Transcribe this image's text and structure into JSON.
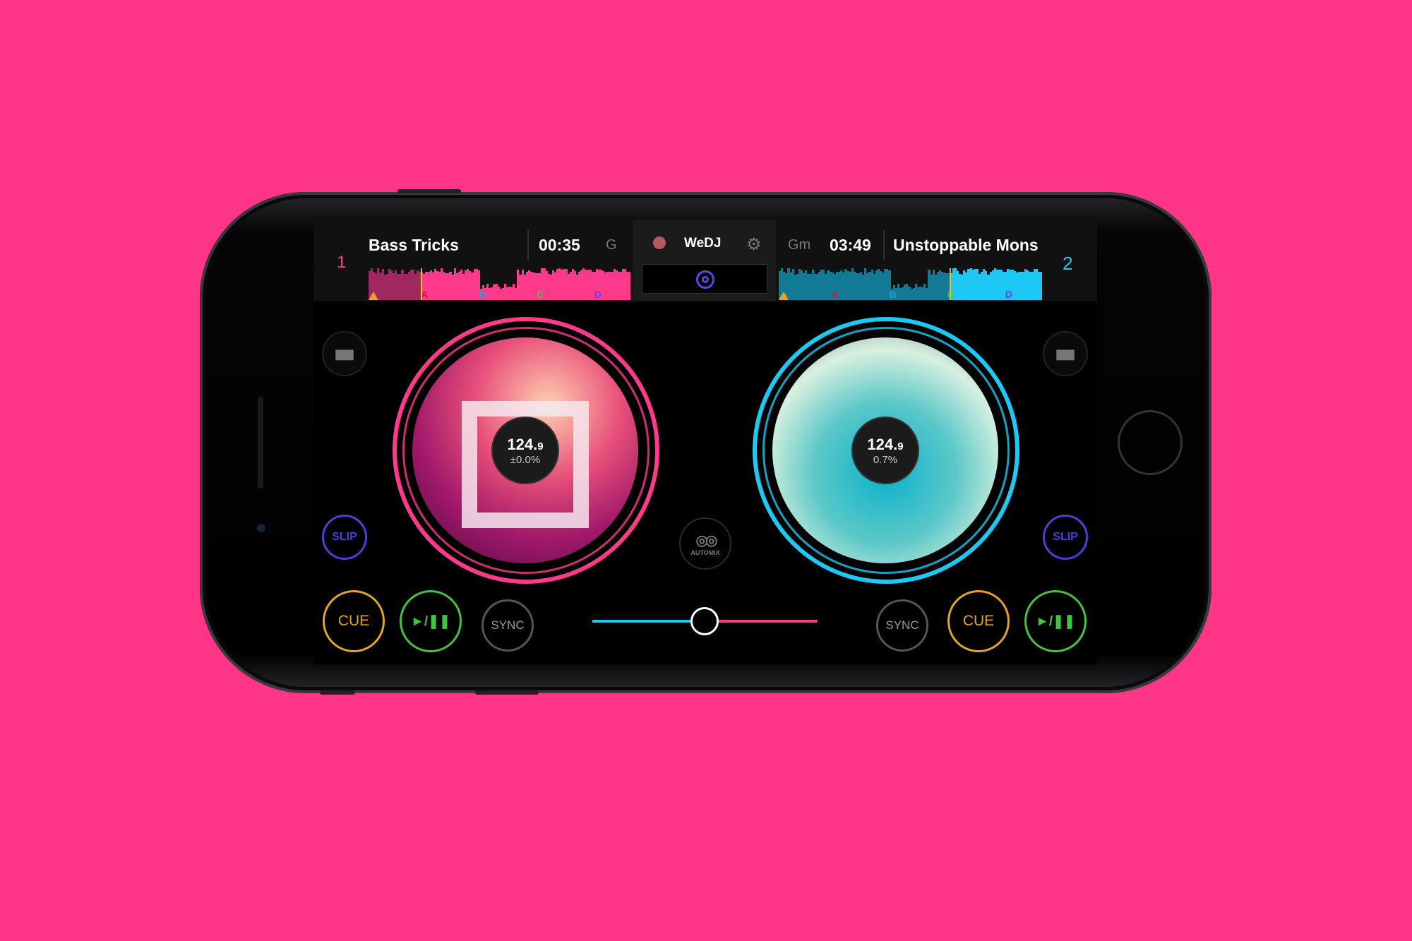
{
  "colors": {
    "background": "#ff3587",
    "deck1": "#ff3a8c",
    "deck2": "#1ec8f5",
    "cue": "#e5a321",
    "play": "#3fc53f",
    "slip": "#4a3fd6",
    "sync": "#888888"
  },
  "app": {
    "name": "WeDJ",
    "record_icon": "record-dot-icon",
    "settings_icon": "gear-icon",
    "browse_icon": "browse-target-icon"
  },
  "deck1": {
    "number": "1",
    "title": "Bass Tricks",
    "time": "00:35",
    "key": "G",
    "bpm_main": "124.",
    "bpm_decimal": "9",
    "pitch": "±0.0%",
    "hot_cues": [
      "A",
      "B",
      "C",
      "D"
    ],
    "slip": "SLIP",
    "cue": "CUE",
    "play": "►/❚❚",
    "sync": "SYNC",
    "playhead": 0.2
  },
  "deck2": {
    "number": "2",
    "title": "Unstoppable Mons",
    "time": "03:49",
    "key": "Gm",
    "bpm_main": "124.",
    "bpm_decimal": "9",
    "pitch": "0.7%",
    "hot_cues": [
      "A",
      "B",
      "C",
      "D"
    ],
    "slip": "SLIP",
    "cue": "CUE",
    "play": "►/❚❚",
    "sync": "SYNC",
    "playhead": 0.65
  },
  "mixer": {
    "automix": "AUTOMIX",
    "crossfader": 0.5
  }
}
